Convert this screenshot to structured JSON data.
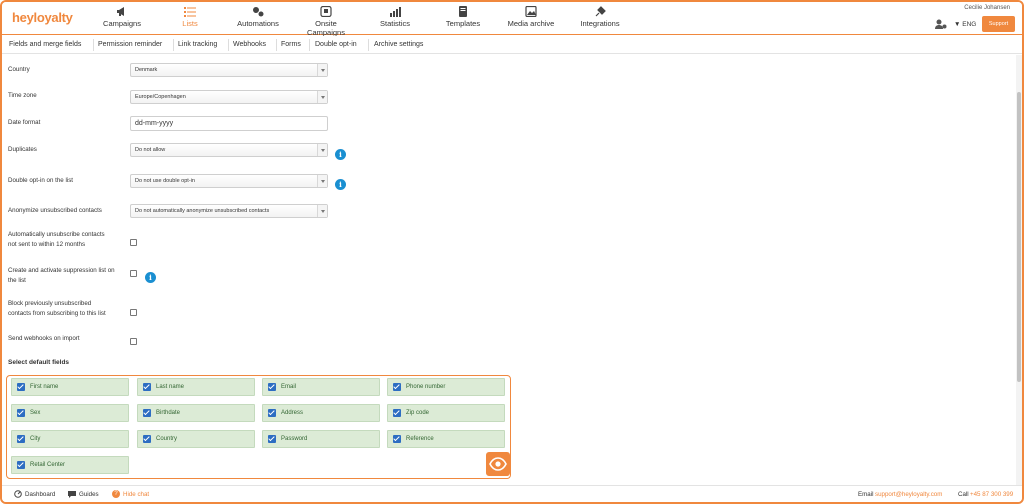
{
  "logo": {
    "hey": "hey",
    "loyalty": "loyalty"
  },
  "nav": [
    {
      "label": "Campaigns",
      "icon": "megaphone-icon"
    },
    {
      "label": "Lists",
      "icon": "list-icon",
      "active": true
    },
    {
      "label": "Automations",
      "icon": "automations-icon"
    },
    {
      "label": "Onsite Campaigns",
      "icon": "onsite-icon"
    },
    {
      "label": "Statistics",
      "icon": "chart-icon"
    },
    {
      "label": "Templates",
      "icon": "template-icon"
    },
    {
      "label": "Media archive",
      "icon": "image-icon"
    },
    {
      "label": "Integrations",
      "icon": "plug-icon"
    }
  ],
  "user": {
    "name": "Cecilie Johansen",
    "lang": "ENG",
    "support": "Support"
  },
  "subnav": [
    "Fields and merge fields",
    "Permission reminder",
    "Link tracking",
    "Webhooks",
    "Forms",
    "Double opt-in",
    "Archive settings"
  ],
  "form": {
    "country": {
      "label": "Country",
      "value": "Denmark"
    },
    "timezone": {
      "label": "Time zone",
      "value": "Europe/Copenhagen"
    },
    "dateformat": {
      "label": "Date format",
      "value": "dd-mm-yyyy"
    },
    "duplicates": {
      "label": "Duplicates",
      "value": "Do not allow"
    },
    "doubleoptin": {
      "label": "Double opt-in on the list",
      "value": "Do not use double opt-in"
    },
    "anonymize": {
      "label": "Anonymize unsubscribed contacts",
      "value": "Do not automatically anonymize unsubscribed contacts"
    },
    "autounsub": {
      "label1": "Automatically unsubscribe contacts",
      "label2": "not sent to within 12 months"
    },
    "suppression": {
      "label1": "Create and activate suppression list on",
      "label2": "the list"
    },
    "block": {
      "label1": "Block previously unsubscribed",
      "label2": "contacts from subscribing to this list"
    },
    "webhooks": {
      "label": "Send webhooks on import"
    }
  },
  "default_fields": {
    "heading": "Select default fields",
    "items": [
      "First name",
      "Last name",
      "Email",
      "Phone number",
      "Sex",
      "Birthdate",
      "Address",
      "Zip code",
      "City",
      "Country",
      "Password",
      "Reference",
      "Retail Center"
    ]
  },
  "footer": {
    "dashboard": "Dashboard",
    "guides": "Guides",
    "hidechat": "Hide chat",
    "email_label": "Email",
    "email": "support@heyloyalty.com",
    "call_label": "Call",
    "phone": "+45 87 300 399"
  },
  "colors": {
    "accent": "#f0883e",
    "info": "#1a8fd1",
    "field_bg": "#dcebd6",
    "check": "#2d6dc2"
  }
}
